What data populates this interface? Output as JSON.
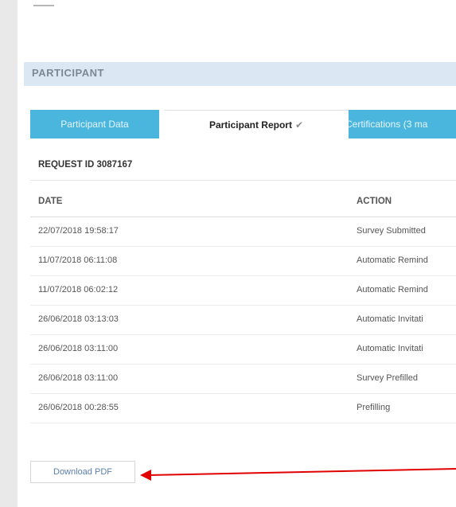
{
  "section": {
    "title": "PARTICIPANT"
  },
  "tabs": [
    {
      "label": "Participant Data"
    },
    {
      "label": "Participant Report",
      "check": "✔"
    },
    {
      "label": "Certifications (3 ma"
    }
  ],
  "request": {
    "label": "REQUEST ID 3087167"
  },
  "table": {
    "headers": {
      "date": "DATE",
      "action": "ACTION"
    },
    "rows": [
      {
        "date": "22/07/2018 19:58:17",
        "action": "Survey Submitted"
      },
      {
        "date": "11/07/2018 06:11:08",
        "action": "Automatic Remind"
      },
      {
        "date": "11/07/2018 06:02:12",
        "action": "Automatic Remind"
      },
      {
        "date": "26/06/2018 03:13:03",
        "action": "Automatic Invitati"
      },
      {
        "date": "26/06/2018 03:11:00",
        "action": "Automatic Invitati"
      },
      {
        "date": "26/06/2018 03:11:00",
        "action": "Survey Prefilled"
      },
      {
        "date": "26/06/2018 00:28:55",
        "action": "Prefilling"
      }
    ]
  },
  "download": {
    "label": "Download PDF"
  },
  "colors": {
    "tab_active_bg": "#ffffff",
    "tab_inactive_bg": "#4bb6dd",
    "header_bg": "#dbe8f3",
    "arrow": "#e00000",
    "link": "#5b7fae"
  }
}
